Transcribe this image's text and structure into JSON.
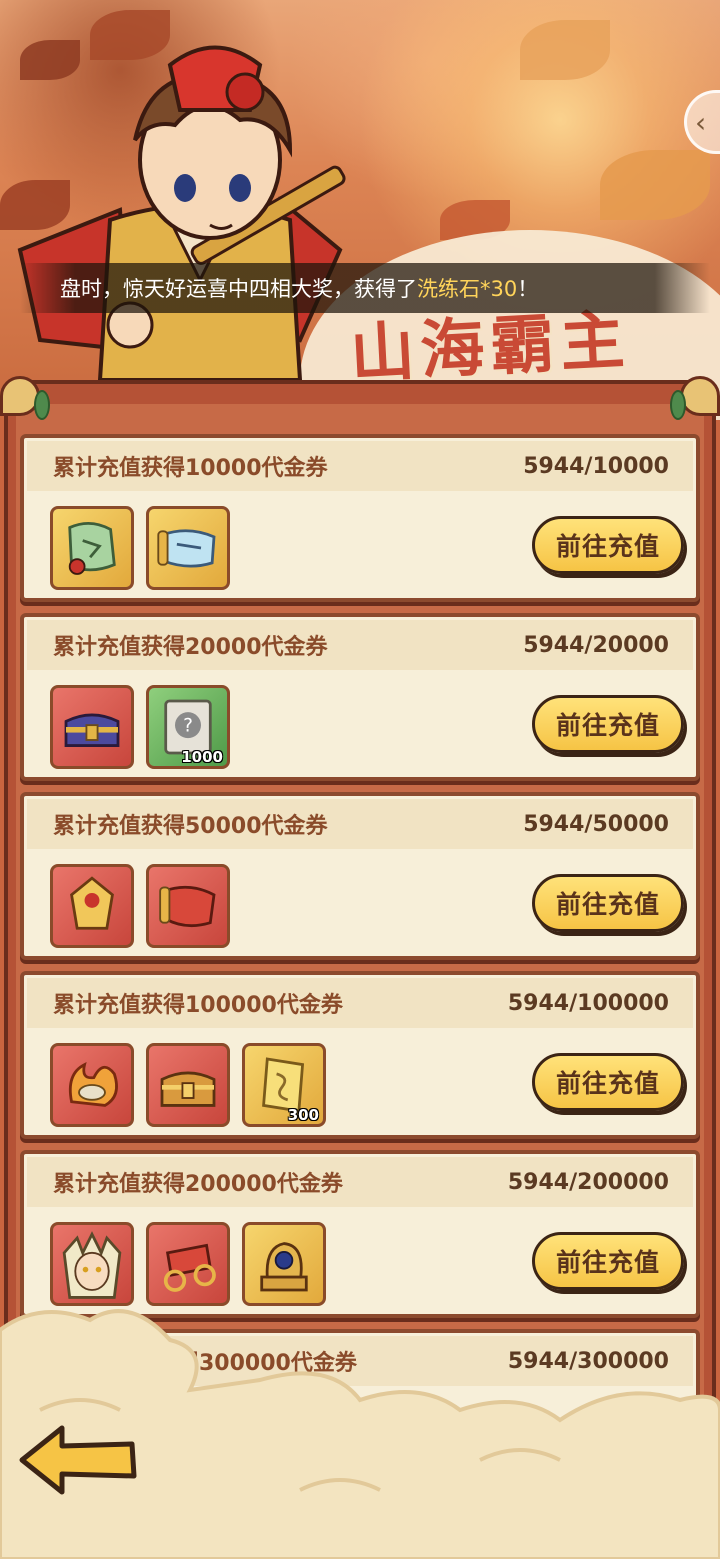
{
  "banner": {
    "title": "山海霸主",
    "marquee_prefix": "盘时，惊天好运喜中四相大奖，获得了",
    "marquee_highlight": "洗练石*30",
    "marquee_suffix": "！"
  },
  "tasks": [
    {
      "title": "累计充值获得10000代金券",
      "progress": "5944/10000",
      "button": "前往充值",
      "items": [
        {
          "icon": "jade-map-scroll-icon",
          "frame": "gold",
          "count": ""
        },
        {
          "icon": "blue-scroll-icon",
          "frame": "gold",
          "count": ""
        }
      ]
    },
    {
      "title": "累计充值获得20000代金券",
      "progress": "5944/20000",
      "button": "前往充值",
      "items": [
        {
          "icon": "purple-chest-icon",
          "frame": "red",
          "count": ""
        },
        {
          "icon": "mystery-scroll-icon",
          "frame": "green",
          "count": "1000"
        }
      ]
    },
    {
      "title": "累计充值获得50000代金券",
      "progress": "5944/50000",
      "button": "前往充值",
      "items": [
        {
          "icon": "golden-emblem-icon",
          "frame": "red",
          "count": ""
        },
        {
          "icon": "red-scroll-icon",
          "frame": "red",
          "count": ""
        }
      ]
    },
    {
      "title": "累计充值获得100000代金券",
      "progress": "5944/100000",
      "button": "前往充值",
      "items": [
        {
          "icon": "flame-artifact-icon",
          "frame": "red",
          "count": ""
        },
        {
          "icon": "golden-chest-icon",
          "frame": "red",
          "count": ""
        },
        {
          "icon": "golden-talisman-icon",
          "frame": "gold",
          "count": "300"
        }
      ]
    },
    {
      "title": "累计充值获得200000代金券",
      "progress": "5944/200000",
      "button": "前往充值",
      "items": [
        {
          "icon": "hero-portrait-icon",
          "frame": "red",
          "count": ""
        },
        {
          "icon": "war-chariot-icon",
          "frame": "red",
          "count": ""
        },
        {
          "icon": "beast-statue-icon",
          "frame": "gold",
          "count": ""
        }
      ]
    },
    {
      "title": "计充值获得300000代金券",
      "progress": "5944/300000",
      "button": "",
      "items": []
    }
  ]
}
